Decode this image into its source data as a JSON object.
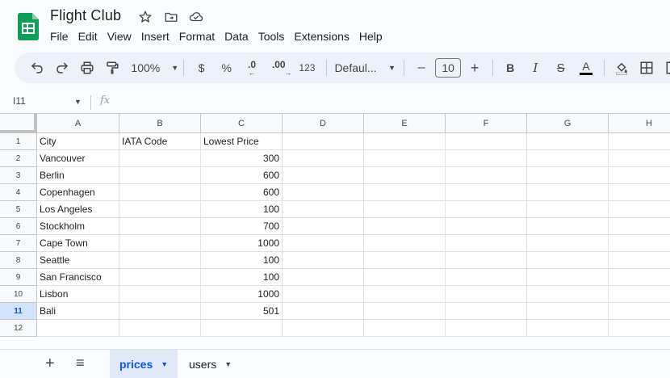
{
  "doc": {
    "title": "Flight Club"
  },
  "menu": [
    "File",
    "Edit",
    "View",
    "Insert",
    "Format",
    "Data",
    "Tools",
    "Extensions",
    "Help"
  ],
  "toolbar": {
    "zoom": "100%",
    "currency": "$",
    "percent": "%",
    "decrease_decimal": ".0",
    "increase_decimal": ".00",
    "number_format": "123",
    "font": "Defaul...",
    "font_size": "10",
    "minus": "–",
    "plus": "+",
    "bold": "B",
    "italic": "I",
    "strike": "S",
    "text_color": "A"
  },
  "formula_bar": {
    "cell_ref": "I11",
    "fx": "fx",
    "value": ""
  },
  "grid": {
    "columns": [
      "A",
      "B",
      "C",
      "D",
      "E",
      "F",
      "G",
      "H"
    ],
    "rows": [
      {
        "num": "1",
        "a": "City",
        "b": "IATA Code",
        "c": "Lowest Price"
      },
      {
        "num": "2",
        "a": "Vancouver",
        "b": "",
        "c": "300"
      },
      {
        "num": "3",
        "a": "Berlin",
        "b": "",
        "c": "600"
      },
      {
        "num": "4",
        "a": "Copenhagen",
        "b": "",
        "c": "600"
      },
      {
        "num": "5",
        "a": "Los Angeles",
        "b": "",
        "c": "100"
      },
      {
        "num": "6",
        "a": "Stockholm",
        "b": "",
        "c": "700"
      },
      {
        "num": "7",
        "a": "Cape Town",
        "b": "",
        "c": "1000"
      },
      {
        "num": "8",
        "a": "Seattle",
        "b": "",
        "c": "100"
      },
      {
        "num": "9",
        "a": "San Francisco",
        "b": "",
        "c": "100"
      },
      {
        "num": "10",
        "a": "Lisbon",
        "b": "",
        "c": "1000"
      },
      {
        "num": "11",
        "a": "Bali",
        "b": "",
        "c": "501"
      },
      {
        "num": "12",
        "a": "",
        "b": "",
        "c": ""
      }
    ],
    "selected_row": "11"
  },
  "sheets": {
    "add": "+",
    "all_sheets": "≡",
    "tabs": [
      {
        "label": "prices",
        "active": true
      },
      {
        "label": "users",
        "active": false
      }
    ]
  },
  "colors": {
    "accent": "#0b57d0",
    "green_logo": "#0f9d58",
    "toolbar_bg": "#edf2fa"
  }
}
